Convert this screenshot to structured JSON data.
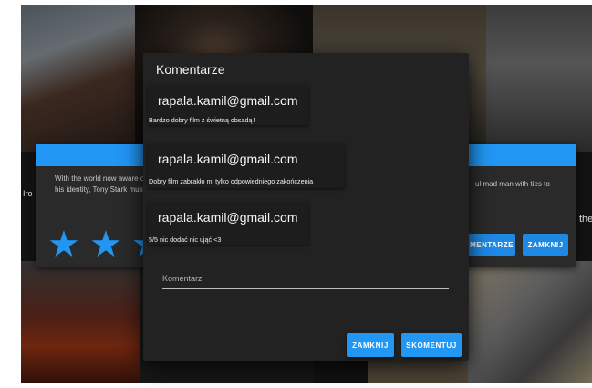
{
  "background": {
    "card_left_description": "With the world now aware of his identity, Tony Stark must contend with his father's legacy.",
    "card_left_side_text": "Iro",
    "card_right_description": "ul mad man with ties to",
    "card_right_side_text": "the",
    "star_rating": 3,
    "star_max": 5,
    "buttons": {
      "comments_label": "MENTARZE",
      "close_label": "ZAMKNIJ"
    },
    "accent_color": "#2196f3"
  },
  "modal": {
    "title": "Komentarze",
    "comments": [
      {
        "author": "rapala.kamil@gmail.com",
        "text": "Bardzo dobry film z świetną obsadą !"
      },
      {
        "author": "rapala.kamil@gmail.com",
        "text": "Dobry film zabrakło mi tylko odpowiedniego zakończenia"
      },
      {
        "author": "rapala.kamil@gmail.com",
        "text": "5/5 nic dodać nic ująć <3"
      }
    ],
    "comment_field": {
      "label": "Komentarz",
      "value": ""
    },
    "buttons": {
      "close_label": "ZAMKNIJ",
      "submit_label": "SKOMENTUJ"
    }
  }
}
